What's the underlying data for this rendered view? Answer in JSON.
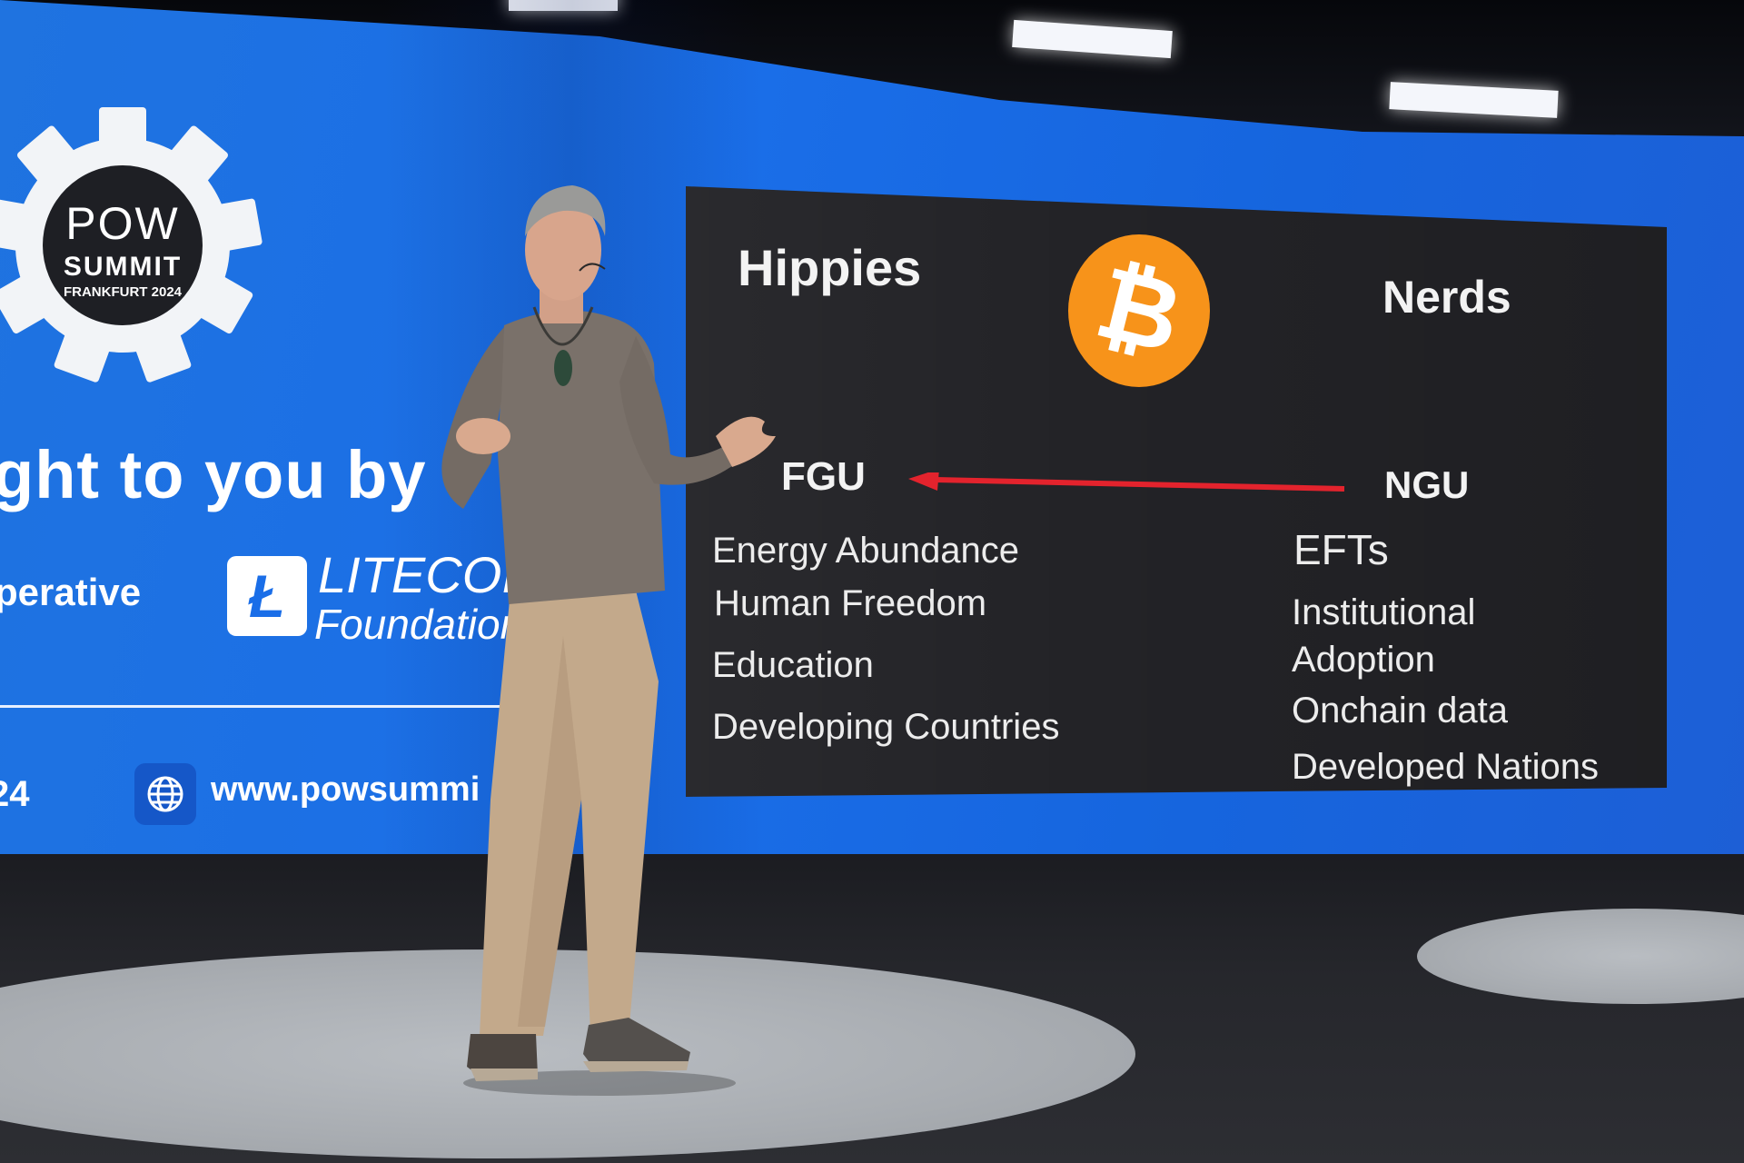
{
  "screen": {
    "logo": {
      "line1": "POW",
      "line2": "SUMMIT",
      "line3": "FRANKFURT 2024"
    },
    "sponsor_heading": "ght to you by",
    "sponsor_left": "perative",
    "litecoin": {
      "name": "LITECOIN",
      "sub": "Foundation"
    },
    "year_fragment": "24",
    "url": "www.powsummi",
    "brand_color": "#1a6ee8"
  },
  "slide": {
    "left_heading": "Hippies",
    "right_heading": "Nerds",
    "left_tag": "FGU",
    "right_tag": "NGU",
    "left_items": [
      "Energy Abundance",
      "Human Freedom",
      "Education",
      "Developing Countries"
    ],
    "right_items": [
      "EFTs",
      "Institutional",
      "Adoption",
      "Onchain data",
      "Developed Nations"
    ],
    "bitcoin_symbol": "₿",
    "bitcoin_color": "#f7931a",
    "arrow_color": "#e3232d"
  },
  "icons": [
    "gear-icon",
    "litecoin-icon",
    "globe-icon",
    "bitcoin-icon",
    "arrow-icon"
  ]
}
